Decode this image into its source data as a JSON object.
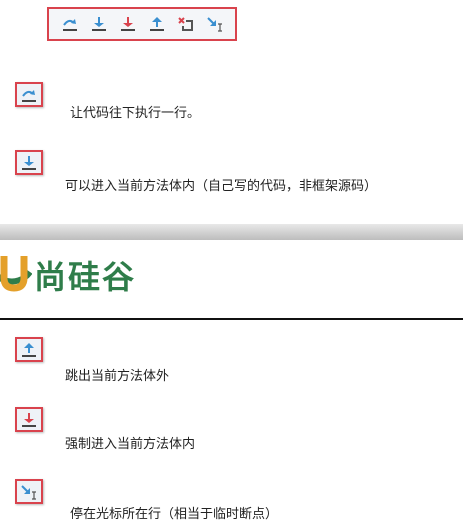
{
  "toolbar": {
    "icons": [
      "step-over-icon",
      "step-into-icon",
      "force-step-into-icon",
      "step-out-icon",
      "drop-frame-icon",
      "run-to-cursor-icon"
    ]
  },
  "items": [
    {
      "icon": "step-over-icon",
      "text": "让代码往下执行一行。"
    },
    {
      "icon": "step-into-icon",
      "text": "可以进入当前方法体内（自己写的代码，非框架源码）"
    },
    {
      "icon": "step-out-icon",
      "text": "跳出当前方法体外"
    },
    {
      "icon": "force-step-into-icon",
      "text": "强制进入当前方法体内"
    },
    {
      "icon": "run-to-cursor-icon",
      "text": "停在光标所在行（相当于临时断点）"
    }
  ],
  "logo": {
    "text": "尚硅谷"
  },
  "colors": {
    "blue": "#3a8fd0",
    "red": "#d9434d",
    "green": "#2f7d4a",
    "orange": "#e4a02a"
  }
}
